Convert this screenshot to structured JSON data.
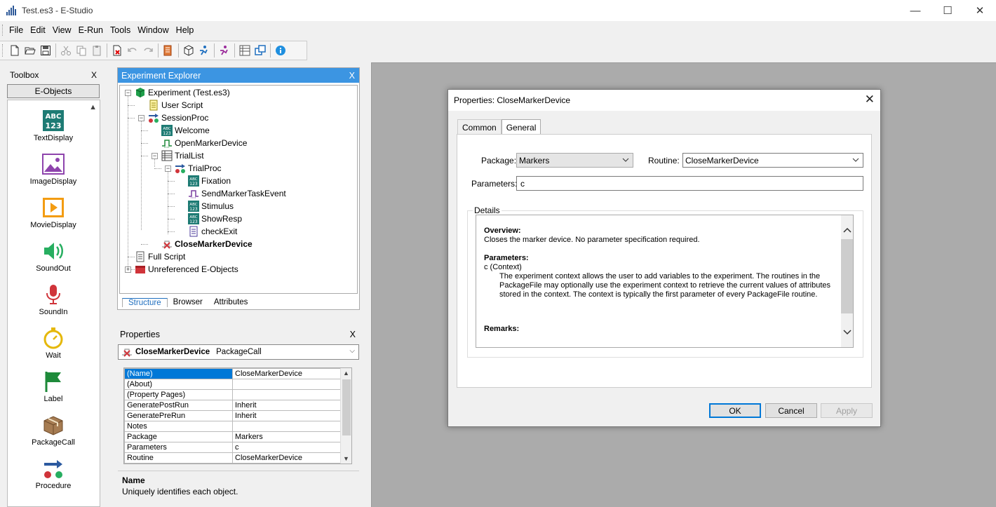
{
  "window": {
    "title": "Test.es3 - E-Studio",
    "minimize": "—",
    "maximize": "☐",
    "close": "✕"
  },
  "menu": [
    "File",
    "Edit",
    "View",
    "E-Run",
    "Tools",
    "Window",
    "Help"
  ],
  "toolbox": {
    "title": "Toolbox",
    "close": "X",
    "tab": "E-Objects",
    "items": [
      "TextDisplay",
      "ImageDisplay",
      "MovieDisplay",
      "SoundOut",
      "SoundIn",
      "Wait",
      "Label",
      "PackageCall",
      "Procedure"
    ]
  },
  "explorer": {
    "title": "Experiment Explorer",
    "close": "X",
    "tree": [
      "Experiment (Test.es3)",
      "User Script",
      "SessionProc",
      "Welcome",
      "OpenMarkerDevice",
      "TrialList",
      "TrialProc",
      "Fixation",
      "SendMarkerTaskEvent",
      "Stimulus",
      "ShowResp",
      "checkExit",
      "CloseMarkerDevice",
      "Full Script",
      "Unreferenced E-Objects"
    ],
    "tabs": [
      "Structure",
      "Browser",
      "Attributes"
    ]
  },
  "properties": {
    "title": "Properties",
    "close": "X",
    "object_name": "CloseMarkerDevice",
    "object_type": "PackageCall",
    "rows": [
      {
        "key": "(Name)",
        "value": "CloseMarkerDevice"
      },
      {
        "key": "(About)",
        "value": ""
      },
      {
        "key": "(Property Pages)",
        "value": ""
      },
      {
        "key": "GeneratePostRun",
        "value": "Inherit"
      },
      {
        "key": "GeneratePreRun",
        "value": "Inherit"
      },
      {
        "key": "Notes",
        "value": ""
      },
      {
        "key": "Package",
        "value": "Markers"
      },
      {
        "key": "Parameters",
        "value": "c"
      },
      {
        "key": "Routine",
        "value": "CloseMarkerDevice"
      }
    ],
    "description_title": "Name",
    "description_text": "Uniquely identifies each object."
  },
  "dialog": {
    "title": "Properties: CloseMarkerDevice",
    "close": "✕",
    "tabs": [
      "Common",
      "General"
    ],
    "package_label": "Package:",
    "package_value": "Markers",
    "routine_label": "Routine:",
    "routine_value": "CloseMarkerDevice",
    "parameters_label": "Parameters:",
    "parameters_value": "c",
    "details_label": "Details",
    "details": {
      "overview_title": "Overview:",
      "overview_text": "Closes the marker device. No parameter specification required.",
      "parameters_title": "Parameters:",
      "parameter_name": "c (Context)",
      "parameter_text": "The experiment context allows the user to add variables to the experiment. The routines in the PackageFile may optionally use the experiment context to retrieve the current values of attributes stored in the context. The context is typically the first parameter of every PackageFile routine.",
      "remarks_title": "Remarks:"
    },
    "ok": "OK",
    "cancel": "Cancel",
    "apply": "Apply"
  },
  "colors": {
    "accent": "#3c95e2",
    "selection": "#0078d7",
    "mdi_background": "#ababab"
  }
}
